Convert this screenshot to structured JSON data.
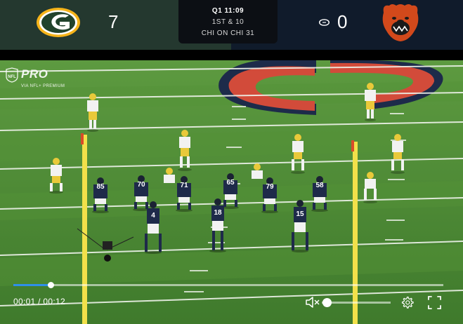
{
  "scoreboard": {
    "home": {
      "team_logo": "green-bay-packers-logo",
      "score": "7",
      "color": "#24382f"
    },
    "away": {
      "team_logo": "chicago-bears-logo",
      "score": "0",
      "color": "#101b2b",
      "possession_icon": "football-icon"
    },
    "game_info": {
      "quarter_clock": "Q1 11:09",
      "down_distance": "1ST & 10",
      "field_position": "CHI ON CHI 31"
    }
  },
  "watermark": {
    "brand": "PRO",
    "subtitle": "VIA NFL+ PREMIUM",
    "icon": "nfl-shield-icon"
  },
  "player": {
    "time_display": "00:01 / 00:12",
    "progress": 0.0865,
    "volume": 0.07,
    "accent_color": "#2f8fe8",
    "icons": [
      "volume-muted-icon",
      "gear-icon",
      "fullscreen-icon"
    ]
  },
  "players": {
    "offense": [
      {
        "number": "85"
      },
      {
        "number": "70"
      },
      {
        "number": "71"
      },
      {
        "number": "65"
      },
      {
        "number": "79"
      },
      {
        "number": "58"
      },
      {
        "number": "4"
      },
      {
        "number": "18"
      },
      {
        "number": "15"
      }
    ]
  }
}
